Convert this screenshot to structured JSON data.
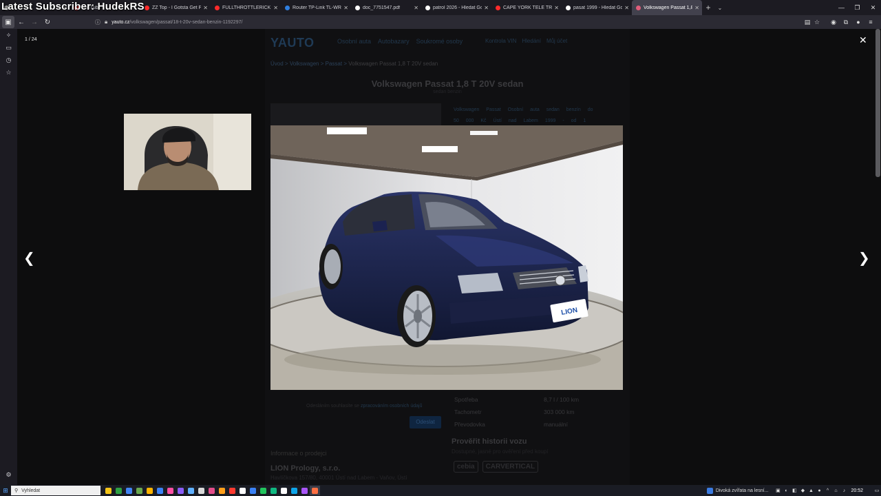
{
  "overlay": {
    "title": "Latest Subscriber: HudekRS"
  },
  "browser": {
    "tabs": [
      {
        "label": "",
        "color": "#9a9a9a",
        "active": false
      },
      {
        "label": "YouTube",
        "color": "#ff2b2b",
        "active": false
      },
      {
        "label": "ZZ Top - I Gotsta Get Pa",
        "color": "#ff2b2b",
        "active": false
      },
      {
        "label": "FULLTHROTTLERICK - YouTu",
        "color": "#ff2b2b",
        "active": false
      },
      {
        "label": "Router TP-Link TL-WR3002X",
        "color": "#2f7fe0",
        "active": false
      },
      {
        "label": "doc_7751547.pdf",
        "color": "#ffffff",
        "active": false
      },
      {
        "label": "patrol 2026 - Hledat Googl",
        "color": "#ffffff",
        "active": false
      },
      {
        "label": "CAPE YORK TELE TRACK LA",
        "color": "#ff2b2b",
        "active": false
      },
      {
        "label": "pasat 1999 - Hledat Googl",
        "color": "#ffffff",
        "active": false
      },
      {
        "label": "Volkswagen Passat 1,8 T 20V",
        "color": "#e05d7a",
        "active": true
      }
    ],
    "url_host": "yauto.cz",
    "url_path": "/volkswagen/passat/18-t-20v-sedan-benzin-1192297/"
  },
  "page": {
    "logo": "YAUTO",
    "menu": [
      "Osobní auta",
      "Autobazary",
      "Soukromé osoby"
    ],
    "menu_right": [
      "Kontrola VIN",
      "Hledání",
      "Můj účet"
    ],
    "breadcrumbs": [
      "Úvod",
      "Volkswagen",
      "Passat"
    ],
    "breadcrumb_current": "Volkswagen Passat 1,8 T 20V sedan",
    "title": "Volkswagen Passat 1,8 T 20V sedan",
    "subtitle": "sedan benzin",
    "tags": "Volkswagen Passat Osobní auta sedan benzín do 50 000 Kč Ústí nad Labem 1999 - od 1 000 Kč",
    "specs": [
      {
        "key": "Spotřeba",
        "value": "8,7 l / 100 km"
      },
      {
        "key": "Tachometr",
        "value": "303 000 km"
      },
      {
        "key": "Převodovka",
        "value": "manuální"
      }
    ],
    "inquiry_text": "Odesláním souhlasíte se",
    "inquiry_link": "zpracováním osobních údajů",
    "send_button": "Odeslat",
    "history_title": "Prověřit historii vozu",
    "history_sub": "Dostupné, jasné pro ověření před koupí",
    "brands": [
      "cebia",
      "CARVERTICAL"
    ],
    "seller_heading": "Informace o prodejci",
    "seller_name": "LION Prology, s.r.o.",
    "seller_address": "Havlíčkova 157/80, 40001 Ústí nad Labem - Vaňov, Ústí"
  },
  "lightbox": {
    "counter": "1 / 24",
    "plate": "LION"
  },
  "taskbar": {
    "search_placeholder": "Vyhledat",
    "notification": "Divoká zvířata na lesní...",
    "time": "20:52",
    "app_colors": [
      "#f5c518",
      "#2ea043",
      "#4285f4",
      "#6aa84f",
      "#ffb400",
      "#3b82f6",
      "#ff4fa3",
      "#8a5cf6",
      "#5fb0ff",
      "#d9d9d9",
      "#e44d8a",
      "#ff9f1a",
      "#ff3b30",
      "#ffffff",
      "#3b82f6",
      "#22c55e",
      "#10b981",
      "#ffffff",
      "#0ea5e9",
      "#a855f7",
      "#ff7043"
    ]
  }
}
